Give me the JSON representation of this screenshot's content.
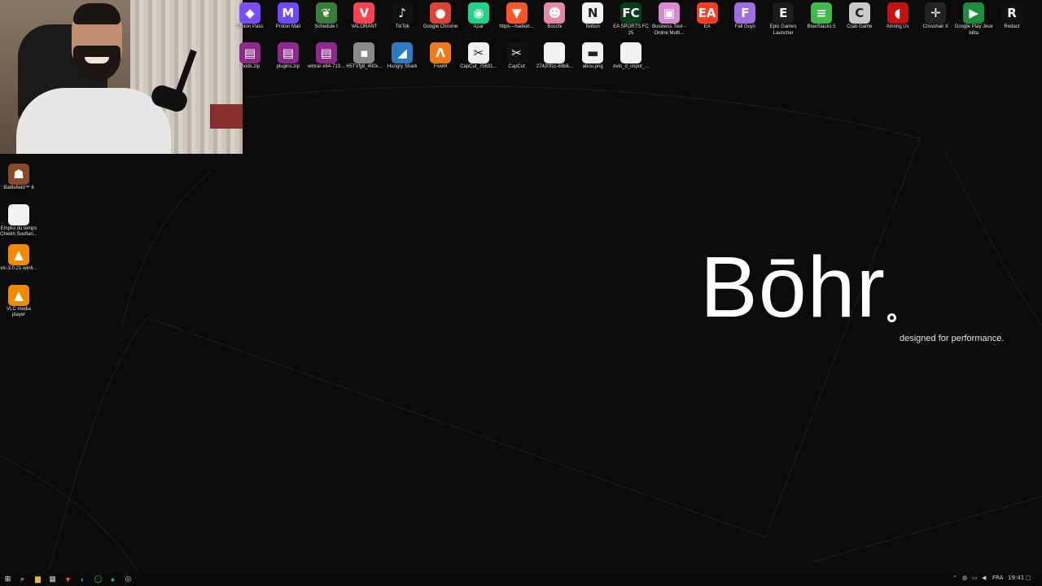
{
  "webcam": {
    "label": "webcam overlay"
  },
  "desktop_top_row": [
    {
      "label": "Proton Pass",
      "icon": "proton-pass-icon",
      "color": "#7b4dff",
      "glyph": "◆"
    },
    {
      "label": "Proton Mail",
      "icon": "proton-mail-icon",
      "color": "#6d4aff",
      "glyph": "M"
    },
    {
      "label": "Schedule I",
      "icon": "schedule-i-icon",
      "color": "#3a7d3a",
      "glyph": "❦"
    },
    {
      "label": "VALORANT",
      "icon": "valorant-icon",
      "color": "#fa4454",
      "glyph": "V"
    },
    {
      "label": "TikTok",
      "icon": "tiktok-icon",
      "color": "#111111",
      "glyph": "♪"
    },
    {
      "label": "Google Chrome",
      "icon": "chrome-icon",
      "color": "#db4437",
      "glyph": "●"
    },
    {
      "label": "Azar",
      "icon": "azar-icon",
      "color": "#23d18b",
      "glyph": "◉"
    },
    {
      "label": "https---hadeet...",
      "icon": "brave-icon",
      "color": "#fb542b",
      "glyph": "▼"
    },
    {
      "label": "Bocchi",
      "icon": "bocchi-icon",
      "color": "#e58aa5",
      "glyph": "☻"
    },
    {
      "label": "Notion",
      "icon": "notion-icon",
      "color": "#f2f2f2",
      "glyph": "N"
    },
    {
      "label": "EA SPORTS FC 25",
      "icon": "ea-fc-icon",
      "color": "#0b3d1c",
      "glyph": "FC"
    },
    {
      "label": "Business Tour - Online Multi...",
      "icon": "business-tour-icon",
      "color": "#d78ad0",
      "glyph": "▣"
    },
    {
      "label": "EA",
      "icon": "ea-icon",
      "color": "#ff3b1f",
      "glyph": "EA"
    },
    {
      "label": "Fall Guys",
      "icon": "fall-guys-icon",
      "color": "#a06ce0",
      "glyph": "F"
    },
    {
      "label": "Epic Games Launcher",
      "icon": "epic-games-icon",
      "color": "#1b1b1b",
      "glyph": "E"
    },
    {
      "label": "BlueStacks 5",
      "icon": "bluestacks-icon",
      "color": "#3fb950",
      "glyph": "≡"
    },
    {
      "label": "Crab Game",
      "icon": "crab-game-icon",
      "color": "#c9c9c9",
      "glyph": "C"
    },
    {
      "label": "Among Us",
      "icon": "among-us-icon",
      "color": "#c51111",
      "glyph": "◖"
    },
    {
      "label": "Crosshair X",
      "icon": "crosshair-x-icon",
      "color": "#222222",
      "glyph": "✛"
    },
    {
      "label": "Google Play Jeux bêta",
      "icon": "google-play-games-icon",
      "color": "#1e8e3e",
      "glyph": "▶"
    },
    {
      "label": "Redact",
      "icon": "redact-icon",
      "color": "#111111",
      "glyph": "R"
    }
  ],
  "desktop_second_row": [
    {
      "label": "mods.zip",
      "icon": "winrar-archive-icon",
      "color": "#8b2a8b",
      "glyph": "▤"
    },
    {
      "label": "plugins.zip",
      "icon": "winrar-archive-icon",
      "color": "#8b2a8b",
      "glyph": "▤"
    },
    {
      "label": "winrar-x64-713...",
      "icon": "winrar-installer-icon",
      "color": "#8b2a8b",
      "glyph": "▤"
    },
    {
      "label": "H5TVfjj8_400x...",
      "icon": "image-file-icon",
      "color": "#8a8a8a",
      "glyph": "▪"
    },
    {
      "label": "Hungry Shark",
      "icon": "hungry-shark-icon",
      "color": "#2f7bbf",
      "glyph": "◢"
    },
    {
      "label": "FiveM",
      "icon": "fivem-icon",
      "color": "#f07a1a",
      "glyph": "Λ"
    },
    {
      "label": "CapCut_75631...",
      "icon": "capcut-installer-icon",
      "color": "#f0f0f0",
      "glyph": "✂"
    },
    {
      "label": "CapCut",
      "icon": "capcut-icon",
      "color": "#111111",
      "glyph": "✂"
    },
    {
      "label": "27420f1c-69b6...",
      "icon": "file-icon",
      "color": "#f2f2f2",
      "glyph": ""
    },
    {
      "label": "abou.png",
      "icon": "png-file-icon",
      "color": "#f2f2f2",
      "glyph": "▬"
    },
    {
      "label": "Avis_d_impot_...",
      "icon": "document-file-icon",
      "color": "#f2f2f2",
      "glyph": ""
    }
  ],
  "desktop_left_column": [
    {
      "label": "Battlefield™ 6",
      "icon": "battlefield-icon",
      "color": "#8a4a2a",
      "glyph": "☗"
    },
    {
      "label": "Emploi du temps Cheikh Soufian...",
      "icon": "document-file-icon",
      "color": "#f2f2f2",
      "glyph": ""
    },
    {
      "label": "vlc-3.0.21-win6...",
      "icon": "vlc-installer-icon",
      "color": "#f08a00",
      "glyph": "▲"
    },
    {
      "label": "VLC media player",
      "icon": "vlc-icon",
      "color": "#f08a00",
      "glyph": "▲"
    }
  ],
  "wallpaper": {
    "brand": "Bōhr",
    "tagline": "designed for performance."
  },
  "taskbar": {
    "apps": [
      {
        "name": "start-button",
        "glyph": "⊞",
        "color": "#ffffff"
      },
      {
        "name": "search-icon",
        "glyph": "⌕",
        "color": "#ffffff"
      },
      {
        "name": "file-explorer-icon",
        "glyph": "▆",
        "color": "#e8b84a"
      },
      {
        "name": "calculator-icon",
        "glyph": "▦",
        "color": "#cfcfcf"
      },
      {
        "name": "brave-taskbar-icon",
        "glyph": "▼",
        "color": "#fb542b"
      },
      {
        "name": "edge-icon",
        "glyph": "◐",
        "color": "#2f9be0"
      },
      {
        "name": "whatsapp-icon",
        "glyph": "◯",
        "color": "#25d366"
      },
      {
        "name": "spotify-icon",
        "glyph": "●",
        "color": "#1db954"
      },
      {
        "name": "obs-icon",
        "glyph": "◎",
        "color": "#cfcfcf"
      }
    ],
    "language": "FRA",
    "time": "19:41"
  }
}
